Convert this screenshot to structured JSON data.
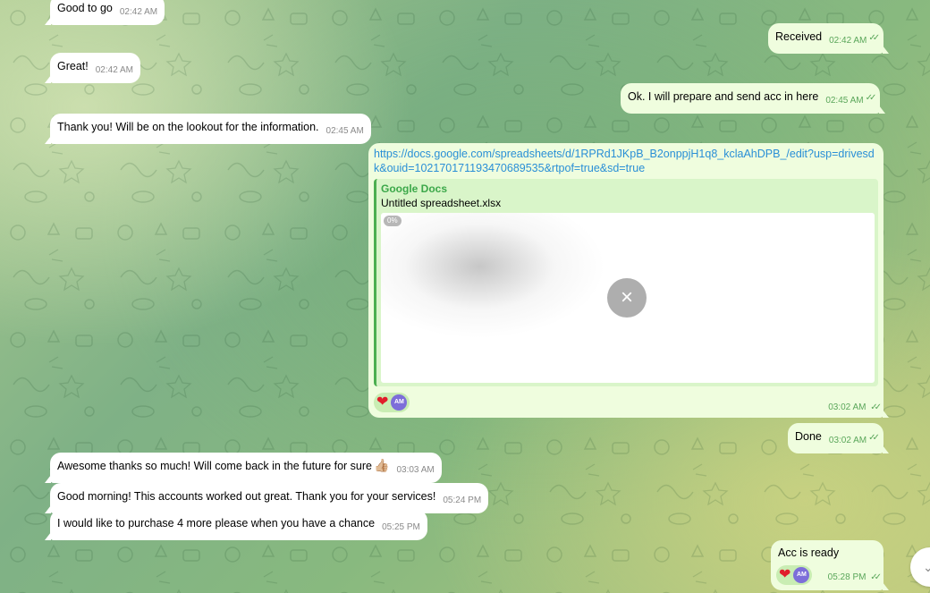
{
  "messages": [
    {
      "id": "m1",
      "dir": "in",
      "text": "Good to go",
      "time": "02:42 AM"
    },
    {
      "id": "m2",
      "dir": "out",
      "text": "Received",
      "time": "02:42 AM"
    },
    {
      "id": "m3",
      "dir": "in",
      "text": "Great!",
      "time": "02:42 AM"
    },
    {
      "id": "m4",
      "dir": "out",
      "text": "Ok.  I will prepare and send acc in here",
      "time": "02:45 AM"
    },
    {
      "id": "m5",
      "dir": "in",
      "text": "Thank you! Will be on the lookout for the information.",
      "time": "02:45 AM"
    },
    {
      "id": "m7",
      "dir": "out",
      "text": "Done",
      "time": "03:02 AM"
    },
    {
      "id": "m8",
      "dir": "in",
      "text": "Awesome thanks so much! Will come back in the future for sure",
      "emoji": "👍🏼",
      "time": "03:03 AM"
    },
    {
      "id": "m9",
      "dir": "in",
      "text": "Good morning! This accounts worked out great. Thank you for your services!",
      "time": "05:24 PM"
    },
    {
      "id": "m10",
      "dir": "in",
      "text": "I would like to purchase 4 more please when you have a chance",
      "time": "05:25 PM"
    }
  ],
  "link_message": {
    "url": "https://docs.google.com/spreadsheets/d/1RPRd1JKpB_B2onppjH1q8_kclaAhDPB_/edit?usp=drivesdk&ouid=102170171193470689535&rtpof=true&sd=true",
    "site": "Google Docs",
    "title": "Untitled spreadsheet.xlsx",
    "progress": "0%",
    "cancel_icon": "×",
    "reaction_emoji": "❤",
    "reaction_avatar": "AM",
    "time": "03:02 AM"
  },
  "last_message": {
    "text": "Acc is ready",
    "reaction_emoji": "❤",
    "reaction_avatar": "AM",
    "time": "05:28 PM"
  },
  "read_checks": "✓✓",
  "scroll_icon": "⌄",
  "colors": {
    "incoming": "#ffffff",
    "outgoing": "#effdde",
    "link": "#2a8fd6",
    "accent_green": "#4caf50",
    "heart": "#e11d2a",
    "avatar": "#7d6ed9"
  }
}
